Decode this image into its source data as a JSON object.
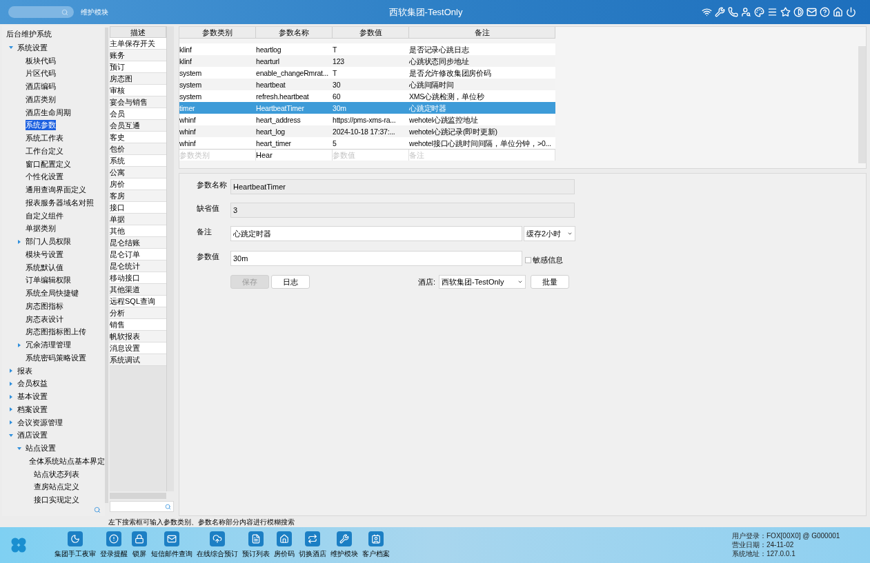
{
  "top_bar": {
    "module": "维护模块",
    "title": "西软集团-TestOnly"
  },
  "tree": {
    "title": "后台维护系统",
    "items": [
      {
        "label": "系统设置",
        "expanded": true,
        "selected": false,
        "children": [
          {
            "label": "板块代码",
            "selected": false
          },
          {
            "label": "片区代码",
            "selected": false
          },
          {
            "label": "酒店编码",
            "selected": false
          },
          {
            "label": "酒店类别",
            "selected": false
          },
          {
            "label": "酒店生命周期",
            "selected": false
          },
          {
            "label": "系统参数",
            "selected": true
          },
          {
            "label": "系统工作表",
            "selected": false
          },
          {
            "label": "工作台定义",
            "selected": false
          },
          {
            "label": "窗口配置定义",
            "selected": false
          },
          {
            "label": "个性化设置",
            "selected": false
          },
          {
            "label": "通用查询界面定义",
            "selected": false
          },
          {
            "label": "报表服务器域名对照",
            "selected": false
          },
          {
            "label": "自定义组件",
            "selected": false
          },
          {
            "label": "单据类别",
            "selected": false
          },
          {
            "label": "部门人员权限",
            "expanded": false,
            "selected": false
          },
          {
            "label": "模块号设置",
            "selected": false
          },
          {
            "label": "系统默认值",
            "selected": false
          },
          {
            "label": "订单编辑权限",
            "selected": false
          },
          {
            "label": "系统全局快捷键",
            "selected": false
          },
          {
            "label": "房态图指标",
            "selected": false
          },
          {
            "label": "房态表设计",
            "selected": false
          },
          {
            "label": "房态图指标图上传",
            "selected": false
          },
          {
            "label": "冗余清理管理",
            "expanded": false,
            "selected": false
          },
          {
            "label": "系统密码策略设置",
            "selected": false
          }
        ]
      },
      {
        "label": "报表",
        "expanded": false,
        "selected": false
      },
      {
        "label": "会员权益",
        "expanded": false,
        "selected": false
      },
      {
        "label": "基本设置",
        "expanded": false,
        "selected": false
      },
      {
        "label": "档案设置",
        "expanded": false,
        "selected": false
      },
      {
        "label": "会议资源管理",
        "expanded": false,
        "selected": false
      },
      {
        "label": "酒店设置",
        "expanded": true,
        "selected": false,
        "children": [
          {
            "label": "站点设置",
            "expanded": true,
            "selected": false,
            "children": [
              {
                "label": "全体系统站点基本界定",
                "selected": false
              },
              {
                "label": "站点状态列表",
                "selected": false
              },
              {
                "label": "查房站点定义",
                "selected": false
              },
              {
                "label": "接口实现定义",
                "selected": false
              }
            ]
          }
        ]
      }
    ]
  },
  "categories": {
    "header": "描述",
    "items": [
      "主单保存开关",
      "账务",
      "预订",
      "房态图",
      "审核",
      "宴会与销售",
      "会员",
      "会员互通",
      "客史",
      "包价",
      "系统",
      "公寓",
      "房价",
      "客房",
      "接口",
      "单据",
      "其他",
      "昆仑结账",
      "昆仑订单",
      "昆仑统计",
      "移动接口",
      "其他渠道",
      "远程SQL查询",
      "分析",
      "销售",
      "帆软报表",
      "消息设置",
      "系统调试"
    ]
  },
  "table": {
    "columns": [
      "参数类别",
      "参数名称",
      "参数值",
      "备注"
    ],
    "rows": [
      {
        "cells": [
          "klinf",
          "heartlog",
          "T",
          "是否记录心跳日志"
        ],
        "selected": false
      },
      {
        "cells": [
          "klinf",
          "hearturl",
          "123",
          "心跳状态同步地址"
        ],
        "selected": false
      },
      {
        "cells": [
          "system",
          "enable_changeRmrat...",
          "T",
          "是否允许修改集团房价码"
        ],
        "selected": false
      },
      {
        "cells": [
          "system",
          "heartbeat",
          "30",
          "心跳间隔时间"
        ],
        "selected": false
      },
      {
        "cells": [
          "system",
          "refresh.heartbeat",
          "60",
          "XMS心跳检测，单位秒"
        ],
        "selected": false
      },
      {
        "cells": [
          "timer",
          "HeartbeatTimer",
          "30m",
          "心跳定时器"
        ],
        "selected": true
      },
      {
        "cells": [
          "whinf",
          "heart_address",
          "https://pms-xms-ra...",
          "wehotel心跳监控地址"
        ],
        "selected": false
      },
      {
        "cells": [
          "whinf",
          "heart_log",
          "2024-10-18 17:37:...",
          "wehotel心跳记录(即时更新)"
        ],
        "selected": false
      },
      {
        "cells": [
          "whinf",
          "heart_timer",
          "5",
          "wehotel接口心跳时间间隔，单位分钟，>0..."
        ],
        "selected": false
      }
    ],
    "filters": [
      {
        "placeholder": "参数类别"
      },
      {
        "value": "Hear"
      },
      {
        "placeholder": "参数值"
      },
      {
        "placeholder": "备注"
      }
    ]
  },
  "form": {
    "name": {
      "label": "参数名称",
      "value": "HeartbeatTimer"
    },
    "default": {
      "label": "缺省值",
      "value": "3"
    },
    "remark": {
      "label": "备注",
      "value": "心跳定时器",
      "cache": "缓存2小时"
    },
    "param": {
      "label": "参数值",
      "value": "30m",
      "sensitive": {
        "label": "敏感信息",
        "checked": false
      }
    },
    "buttons": [
      {
        "label": "保存",
        "disabled": true
      },
      {
        "label": "日志",
        "disabled": false
      }
    ],
    "hotel": {
      "label": "酒店:",
      "value": "西软集团-TestOnly"
    },
    "batch": "批量"
  },
  "hint": "左下搜索框可输入参数类别、参数名称部分内容进行模糊搜索",
  "dock": {
    "items": [
      {
        "label": "集团手工夜审"
      },
      {
        "label": "登录提醒"
      },
      {
        "label": "锁屏"
      },
      {
        "label": "短信邮件查询"
      },
      {
        "label": "在线综合预订"
      },
      {
        "label": "预订列表"
      },
      {
        "label": "房价码"
      },
      {
        "label": "切换酒店"
      },
      {
        "label": "维护模块"
      },
      {
        "label": "客户档案"
      }
    ],
    "info": [
      "用户登录：FOX[00X0] @ G000001",
      "营业日期：24-11-02",
      "系统地址：127.0.0.1"
    ]
  }
}
